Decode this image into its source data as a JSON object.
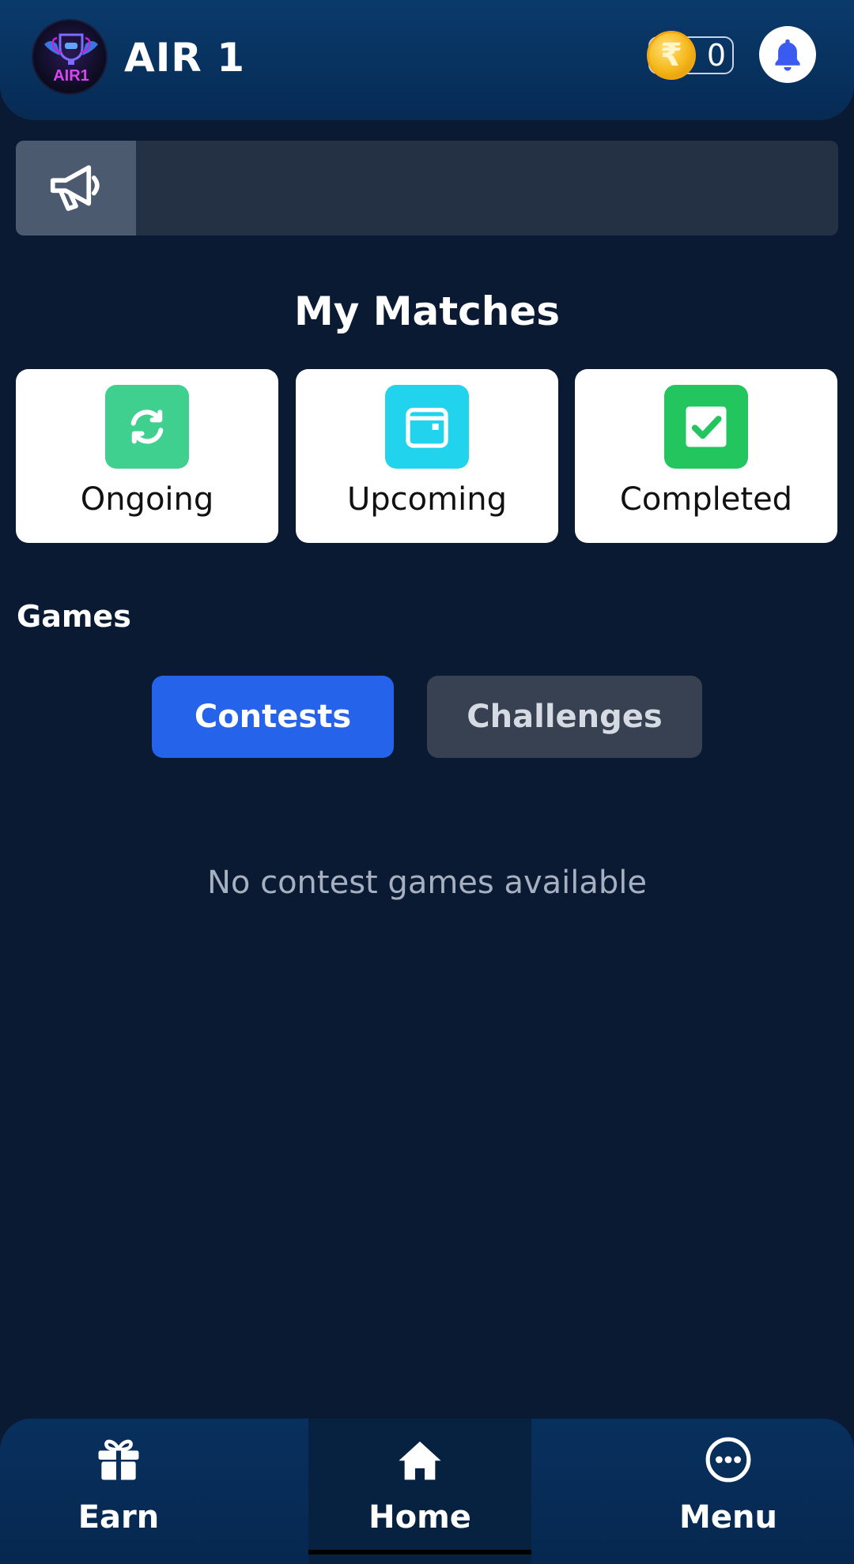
{
  "header": {
    "app_title": "AIR 1",
    "logo_text": "AIR1",
    "wallet": {
      "currency_symbol": "₹",
      "balance": "0"
    }
  },
  "announcement": {
    "text": ""
  },
  "my_matches": {
    "title": "My Matches",
    "cards": [
      {
        "label": "Ongoing",
        "icon": "refresh-icon",
        "color": "#3fcf8e"
      },
      {
        "label": "Upcoming",
        "icon": "calendar-icon",
        "color": "#22d3ee"
      },
      {
        "label": "Completed",
        "icon": "check-icon",
        "color": "#22c55e"
      }
    ]
  },
  "games": {
    "label": "Games",
    "tabs": [
      {
        "label": "Contests",
        "active": true
      },
      {
        "label": "Challenges",
        "active": false
      }
    ],
    "empty_message": "No contest games available"
  },
  "bottom_nav": {
    "items": [
      {
        "label": "Earn",
        "icon": "gift-icon"
      },
      {
        "label": "Home",
        "icon": "home-icon",
        "active": true
      },
      {
        "label": "Menu",
        "icon": "more-circle-icon"
      }
    ]
  },
  "colors": {
    "background": "#0b1a33",
    "accent_blue": "#2563eb",
    "bell_accent": "#3b5bf0"
  }
}
